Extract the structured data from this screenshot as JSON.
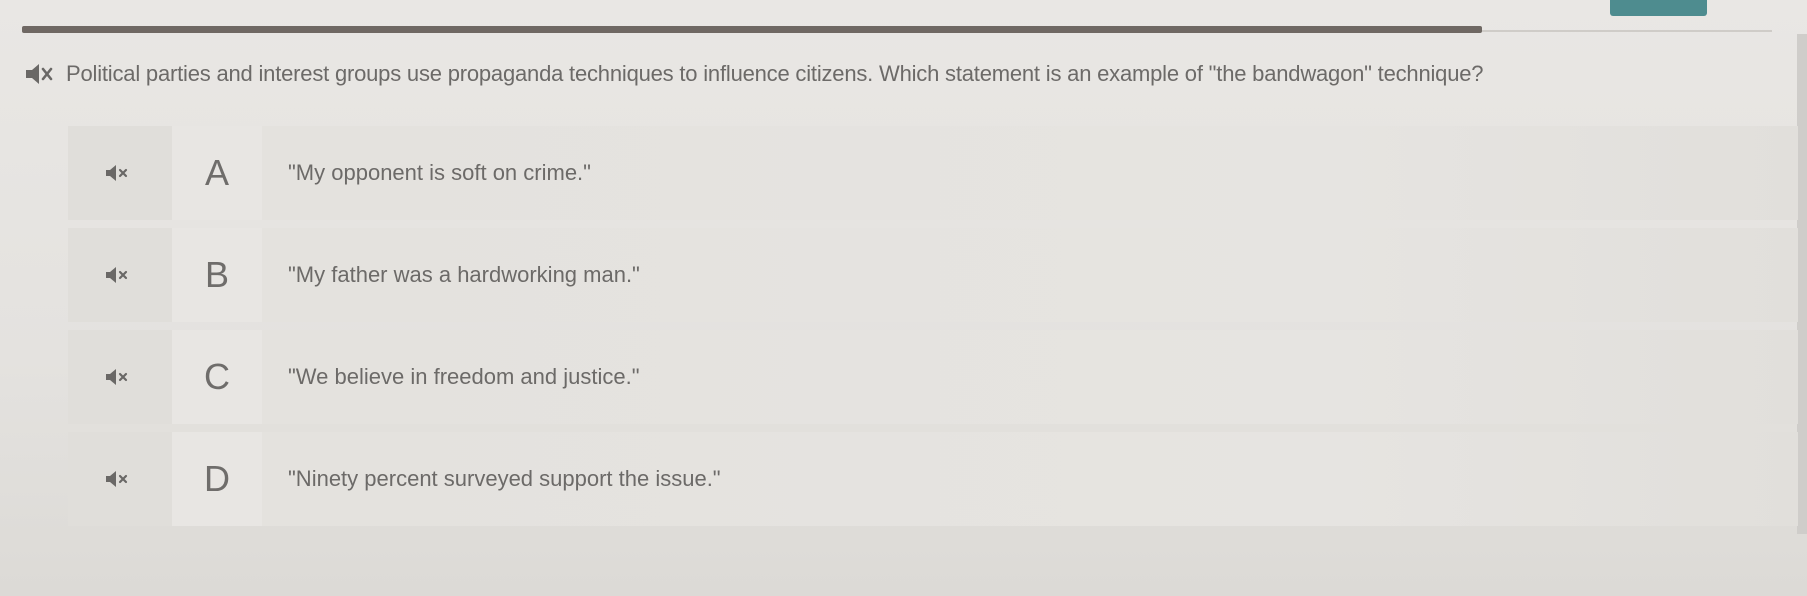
{
  "question": {
    "text": "Political parties and interest groups use propaganda techniques to influence citizens. Which statement is an example of \"the bandwagon\" technique?",
    "audio_icon": "speaker-icon"
  },
  "options": [
    {
      "letter": "A",
      "text": "\"My opponent is soft on crime.\"",
      "audio_icon": "speaker-icon"
    },
    {
      "letter": "B",
      "text": "\"My father was a hardworking man.\"",
      "audio_icon": "speaker-icon"
    },
    {
      "letter": "C",
      "text": "\"We believe in freedom and justice.\"",
      "audio_icon": "speaker-icon"
    },
    {
      "letter": "D",
      "text": "\"Ninety percent surveyed support the issue.\"",
      "audio_icon": "speaker-icon"
    }
  ],
  "colors": {
    "accent": "#4e8c8f",
    "text": "#6c6a68",
    "background": "#e6e4e1"
  }
}
